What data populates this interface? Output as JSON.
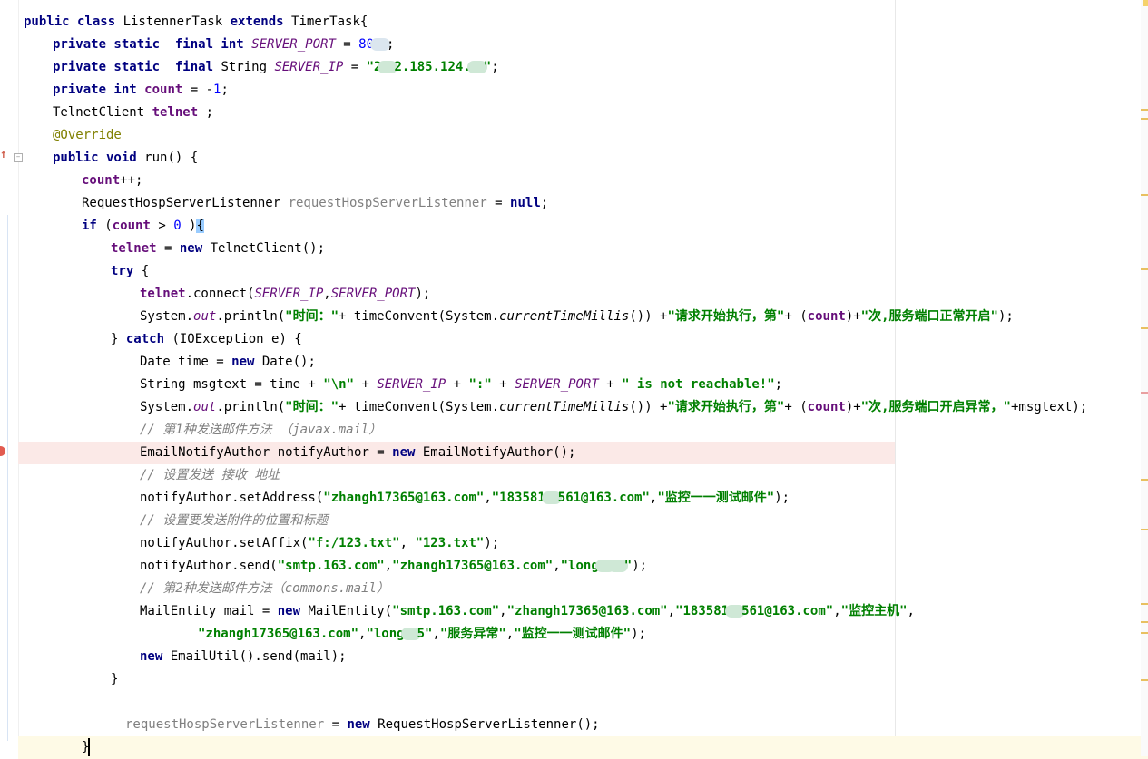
{
  "editor": {
    "lines": [
      {
        "t": [
          [
            "kw",
            "public class "
          ],
          [
            "p",
            "ListennerTask "
          ],
          [
            "kw",
            "extends "
          ],
          [
            "p",
            "TimerTask{"
          ]
        ]
      },
      {
        "t": [
          [
            "kw",
            "private static  final int "
          ],
          [
            "sfld",
            "SERVER_PORT"
          ],
          [
            "p",
            " = "
          ],
          [
            "num",
            "80"
          ],
          [
            "blur",
            ""
          ],
          [
            "p",
            ";"
          ]
        ]
      },
      {
        "t": [
          [
            "kw",
            "private static  final "
          ],
          [
            "p",
            "String "
          ],
          [
            "sfld",
            "SERVER_IP"
          ],
          [
            "p",
            " = "
          ],
          [
            "str",
            "\"2"
          ],
          [
            "blurg",
            ""
          ],
          [
            "str",
            "2.185.124."
          ],
          [
            "blurg",
            ""
          ],
          [
            "str",
            "\""
          ],
          [
            "p",
            ";"
          ]
        ]
      },
      {
        "t": [
          [
            "kw",
            "private int "
          ],
          [
            "fld",
            "count"
          ],
          [
            "p",
            " = -"
          ],
          [
            "num",
            "1"
          ],
          [
            "p",
            ";"
          ]
        ]
      },
      {
        "t": [
          [
            "p",
            "TelnetClient "
          ],
          [
            "fld",
            "telnet"
          ],
          [
            "p",
            " ;"
          ]
        ]
      },
      {
        "t": [
          [
            "ann",
            "@Override"
          ]
        ]
      },
      {
        "t": [
          [
            "kw",
            "public void "
          ],
          [
            "p",
            "run() {"
          ]
        ]
      },
      {
        "t": [
          [
            "fld",
            "count"
          ],
          [
            "p",
            "++;"
          ]
        ]
      },
      {
        "t": [
          [
            "p",
            "RequestHospServerListenner "
          ],
          [
            "unused",
            "requestHospServerListenner"
          ],
          [
            "p",
            " = "
          ],
          [
            "kw",
            "null"
          ],
          [
            "p",
            ";"
          ]
        ]
      },
      {
        "t": [
          [
            "kw",
            "if "
          ],
          [
            "p",
            "("
          ],
          [
            "fld",
            "count"
          ],
          [
            "p",
            " > "
          ],
          [
            "num",
            "0"
          ],
          [
            "p",
            " )"
          ],
          [
            "bm",
            "{"
          ]
        ]
      },
      {
        "t": [
          [
            "fld",
            "telnet"
          ],
          [
            "p",
            " = "
          ],
          [
            "kw",
            "new "
          ],
          [
            "p",
            "TelnetClient();"
          ]
        ]
      },
      {
        "t": [
          [
            "kw",
            "try "
          ],
          [
            "p",
            "{"
          ]
        ]
      },
      {
        "t": [
          [
            "fld",
            "telnet"
          ],
          [
            "p",
            ".connect("
          ],
          [
            "sfld",
            "SERVER_IP"
          ],
          [
            "p",
            ","
          ],
          [
            "sfld",
            "SERVER_PORT"
          ],
          [
            "p",
            ");"
          ]
        ]
      },
      {
        "t": [
          [
            "p",
            "System."
          ],
          [
            "sfld",
            "out"
          ],
          [
            "p",
            ".println("
          ],
          [
            "str",
            "\"时间：\""
          ],
          [
            "p",
            "+ timeConvent(System."
          ],
          [
            "sta",
            "currentTimeMillis"
          ],
          [
            "p",
            "()) +"
          ],
          [
            "str",
            "\"请求开始执行，第\""
          ],
          [
            "p",
            "+ ("
          ],
          [
            "fld",
            "count"
          ],
          [
            "p",
            ")+"
          ],
          [
            "str",
            "\"次,服务端口正常开启\""
          ],
          [
            "p",
            ");"
          ]
        ]
      },
      {
        "t": [
          [
            "p",
            "} "
          ],
          [
            "kw",
            "catch "
          ],
          [
            "p",
            "(IOException e) {"
          ]
        ]
      },
      {
        "t": [
          [
            "p",
            "Date time = "
          ],
          [
            "kw",
            "new "
          ],
          [
            "p",
            "Date();"
          ]
        ]
      },
      {
        "t": [
          [
            "p",
            "String msgtext = time + "
          ],
          [
            "str",
            "\"\\n\""
          ],
          [
            "p",
            " + "
          ],
          [
            "sfld",
            "SERVER_IP"
          ],
          [
            "p",
            " + "
          ],
          [
            "str",
            "\":\""
          ],
          [
            "p",
            " + "
          ],
          [
            "sfld",
            "SERVER_PORT"
          ],
          [
            "p",
            " + "
          ],
          [
            "str",
            "\" is not reachable!\""
          ],
          [
            "p",
            ";"
          ]
        ]
      },
      {
        "t": [
          [
            "p",
            "System."
          ],
          [
            "sfld",
            "out"
          ],
          [
            "p",
            ".println("
          ],
          [
            "str",
            "\"时间：\""
          ],
          [
            "p",
            "+ timeConvent(System."
          ],
          [
            "sta",
            "currentTimeMillis"
          ],
          [
            "p",
            "()) +"
          ],
          [
            "str",
            "\"请求开始执行，第\""
          ],
          [
            "p",
            "+ ("
          ],
          [
            "fld",
            "count"
          ],
          [
            "p",
            ")+"
          ],
          [
            "str",
            "\"次,服务端口开启异常，\""
          ],
          [
            "p",
            "+msgtext);"
          ]
        ]
      },
      {
        "t": [
          [
            "cmt",
            "// 第1种发送邮件方法 （javax.mail）"
          ]
        ]
      },
      {
        "t": [
          [
            "p",
            "EmailNotifyAuthor notifyAuthor = "
          ],
          [
            "kw",
            "new "
          ],
          [
            "p",
            "EmailNotifyAuthor();"
          ]
        ]
      },
      {
        "t": [
          [
            "cmt",
            "// 设置发送 接收 地址"
          ]
        ]
      },
      {
        "t": [
          [
            "p",
            "notifyAuthor.setAddress("
          ],
          [
            "str",
            "\"zhangh17365@163.com\""
          ],
          [
            "p",
            ","
          ],
          [
            "str",
            "\"183581"
          ],
          [
            "blurg",
            ""
          ],
          [
            "str",
            "561@163.com\""
          ],
          [
            "p",
            ","
          ],
          [
            "str",
            "\"监控一一测试邮件\""
          ],
          [
            "p",
            ");"
          ]
        ]
      },
      {
        "t": [
          [
            "cmt",
            "// 设置要发送附件的位置和标题"
          ]
        ]
      },
      {
        "t": [
          [
            "p",
            "notifyAuthor.setAffix("
          ],
          [
            "str",
            "\"f:/123.txt\""
          ],
          [
            "p",
            ", "
          ],
          [
            "str",
            "\"123.txt\""
          ],
          [
            "p",
            ");"
          ]
        ]
      },
      {
        "t": [
          [
            "p",
            "notifyAuthor.send("
          ],
          [
            "str",
            "\"smtp.163.com\""
          ],
          [
            "p",
            ","
          ],
          [
            "str",
            "\"zhangh17365@163.com\""
          ],
          [
            "p",
            ","
          ],
          [
            "str",
            "\"long"
          ],
          [
            "blurg",
            ""
          ],
          [
            "blurg",
            ""
          ],
          [
            "str",
            "\""
          ],
          [
            "p",
            ");"
          ]
        ]
      },
      {
        "t": [
          [
            "cmt",
            "// 第2种发送邮件方法（commons.mail）"
          ]
        ]
      },
      {
        "t": [
          [
            "p",
            "MailEntity mail = "
          ],
          [
            "kw",
            "new "
          ],
          [
            "p",
            "MailEntity("
          ],
          [
            "str",
            "\"smtp.163.com\""
          ],
          [
            "p",
            ","
          ],
          [
            "str",
            "\"zhangh17365@163.com\""
          ],
          [
            "p",
            ","
          ],
          [
            "str",
            "\"183581"
          ],
          [
            "blurg",
            ""
          ],
          [
            "str",
            "561@163.com\""
          ],
          [
            "p",
            ","
          ],
          [
            "str",
            "\"监控主机\""
          ],
          [
            "p",
            ","
          ]
        ]
      },
      {
        "t": [
          [
            "str",
            "\"zhangh17365@163.com\""
          ],
          [
            "p",
            ","
          ],
          [
            "str",
            "\"long"
          ],
          [
            "blurg",
            ""
          ],
          [
            "str",
            "5\""
          ],
          [
            "p",
            ","
          ],
          [
            "str",
            "\"服务异常\""
          ],
          [
            "p",
            ","
          ],
          [
            "str",
            "\"监控一一测试邮件\""
          ],
          [
            "p",
            ");"
          ]
        ]
      },
      {
        "t": [
          [
            "kw",
            "new "
          ],
          [
            "p",
            "EmailUtil().send(mail);"
          ]
        ]
      },
      {
        "t": [
          [
            "p",
            "}"
          ]
        ]
      },
      {
        "t": []
      },
      {
        "t": [
          [
            "unused",
            "requestHospServerListenner"
          ],
          [
            "p",
            " = "
          ],
          [
            "kw",
            "new "
          ],
          [
            "p",
            "RequestHospServerListenner();"
          ]
        ]
      },
      {
        "t": [
          [
            "p",
            "}"
          ],
          [
            "caret",
            ""
          ]
        ]
      }
    ]
  },
  "colors": {
    "keyword": "#000080",
    "field": "#660e7a",
    "string": "#008000",
    "number": "#0000ff",
    "annotation": "#808000",
    "comment": "#808080",
    "breakpoint": "#e25b50"
  },
  "icons": [
    "override-arrow-icon",
    "breakpoint-icon",
    "fold-icon"
  ]
}
